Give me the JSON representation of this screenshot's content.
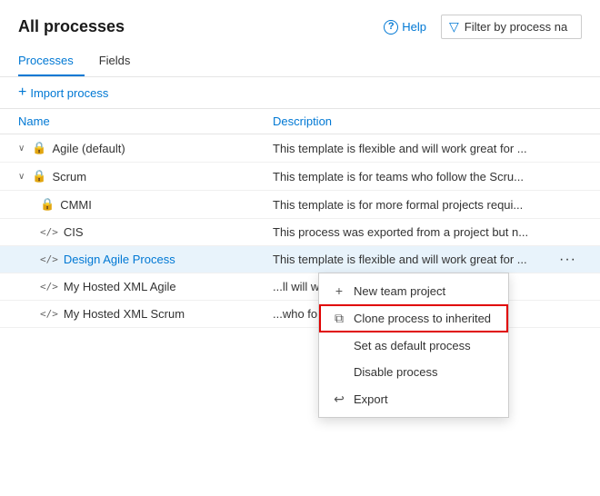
{
  "page": {
    "title": "All processes"
  },
  "header": {
    "help_label": "Help",
    "filter_placeholder": "Filter by process na"
  },
  "tabs": [
    {
      "id": "processes",
      "label": "Processes",
      "active": true
    },
    {
      "id": "fields",
      "label": "Fields",
      "active": false
    }
  ],
  "toolbar": {
    "import_label": "Import process"
  },
  "table": {
    "col_name": "Name",
    "col_desc": "Description",
    "rows": [
      {
        "id": "agile",
        "indent": false,
        "has_chevron": true,
        "icon": "lock",
        "name": "Agile (default)",
        "is_link": false,
        "desc": "This template is flexible and will work great for ...",
        "selected": false,
        "show_ellipsis": false
      },
      {
        "id": "scrum",
        "indent": false,
        "has_chevron": true,
        "icon": "lock",
        "name": "Scrum",
        "is_link": false,
        "desc": "This template is for teams who follow the Scru...",
        "selected": false,
        "show_ellipsis": false
      },
      {
        "id": "cmmi",
        "indent": false,
        "has_chevron": false,
        "icon": "lock",
        "name": "CMMI",
        "is_link": false,
        "desc": "This template is for more formal projects requi...",
        "selected": false,
        "show_ellipsis": false
      },
      {
        "id": "cis",
        "indent": false,
        "has_chevron": false,
        "icon": "code",
        "name": "CIS",
        "is_link": false,
        "desc": "This process was exported from a project but n...",
        "selected": false,
        "show_ellipsis": false
      },
      {
        "id": "design-agile",
        "indent": false,
        "has_chevron": false,
        "icon": "code",
        "name": "Design Agile Process",
        "is_link": true,
        "desc": "This template is flexible and will work great for ...",
        "selected": true,
        "show_ellipsis": true
      },
      {
        "id": "my-hosted-xml-agile",
        "indent": false,
        "has_chevron": false,
        "icon": "code",
        "name": "My Hosted XML Agile",
        "is_link": false,
        "desc": "...ll work great for ...",
        "selected": false,
        "show_ellipsis": false
      },
      {
        "id": "my-hosted-xml-scrum",
        "indent": false,
        "has_chevron": false,
        "icon": "code",
        "name": "My Hosted XML Scrum",
        "is_link": false,
        "desc": "...who follow the Scru...",
        "selected": false,
        "show_ellipsis": false
      }
    ]
  },
  "context_menu": {
    "items": [
      {
        "id": "new-team-project",
        "icon": "plus",
        "label": "New team project",
        "highlighted": false
      },
      {
        "id": "clone-process",
        "icon": "copy",
        "label": "Clone process to inherited",
        "highlighted": true
      },
      {
        "id": "set-default",
        "icon": "",
        "label": "Set as default process",
        "highlighted": false
      },
      {
        "id": "disable-process",
        "icon": "",
        "label": "Disable process",
        "highlighted": false
      },
      {
        "id": "export",
        "icon": "export",
        "label": "Export",
        "highlighted": false
      }
    ]
  }
}
